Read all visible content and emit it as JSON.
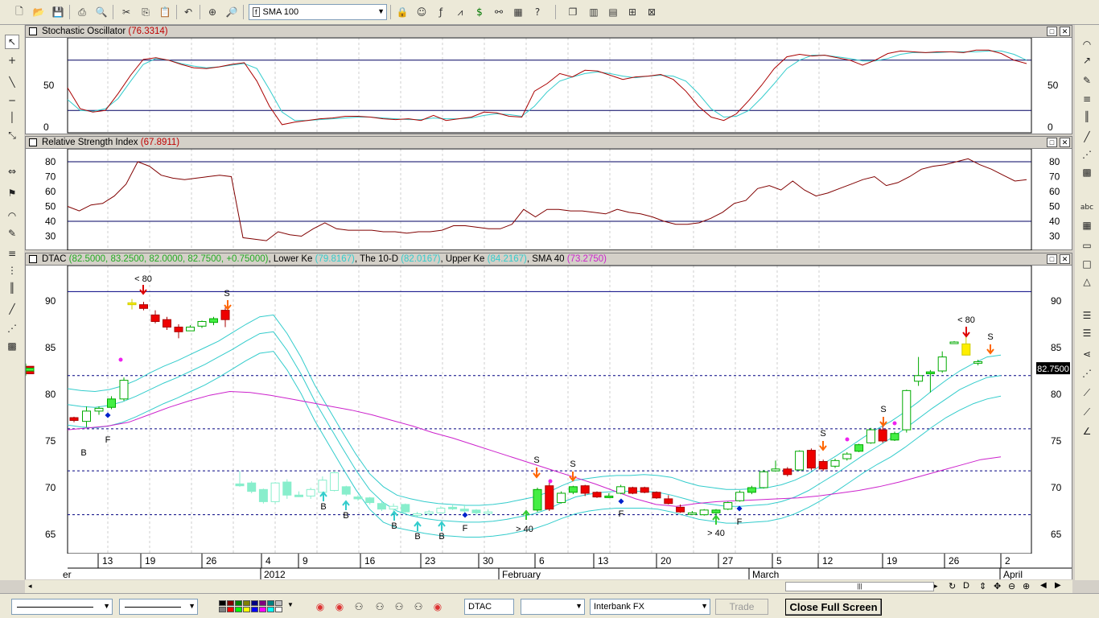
{
  "toolbar": {
    "indicator_select": "SMA 100"
  },
  "stochastic": {
    "title": "Stochastic Oscillator",
    "value": "(76.3314)",
    "axis": [
      "50",
      "0"
    ],
    "upper": 80,
    "lower": 20,
    "k": [
      47,
      22,
      18,
      20,
      40,
      62,
      81,
      83,
      80,
      75,
      71,
      70,
      72,
      75,
      77,
      55,
      25,
      3,
      6,
      8,
      10,
      11,
      13,
      13,
      12,
      10,
      9,
      10,
      8,
      14,
      8,
      10,
      12,
      18,
      17,
      13,
      12,
      43,
      52,
      64,
      60,
      68,
      67,
      62,
      57,
      60,
      61,
      63,
      57,
      43,
      25,
      12,
      8,
      16,
      32,
      50,
      70,
      84,
      87,
      85,
      86,
      83,
      80,
      74,
      80,
      88,
      91,
      90,
      89,
      90,
      90,
      89,
      92,
      92,
      88,
      80,
      76
    ],
    "d": [
      33,
      20,
      19,
      22,
      34,
      55,
      75,
      82,
      80,
      76,
      73,
      71,
      72,
      74,
      76,
      70,
      45,
      18,
      8,
      8,
      9,
      10,
      11,
      12,
      12,
      11,
      10,
      9,
      9,
      11,
      10,
      10,
      11,
      14,
      16,
      15,
      13,
      25,
      42,
      55,
      60,
      64,
      66,
      64,
      61,
      59,
      61,
      62,
      61,
      55,
      40,
      22,
      12,
      13,
      20,
      35,
      52,
      70,
      80,
      86,
      86,
      84,
      82,
      79,
      79,
      82,
      87,
      89,
      89,
      89,
      90,
      90,
      90,
      91,
      91,
      87,
      80
    ]
  },
  "rsi": {
    "title": "Relative Strength Index",
    "value": "(67.8911)",
    "axis": [
      "80",
      "70",
      "60",
      "50",
      "40",
      "30"
    ],
    "upper": 80,
    "lower": 40,
    "values": [
      50,
      47,
      51,
      52,
      57,
      65,
      80,
      77,
      71,
      69,
      68,
      69,
      70,
      71,
      70,
      29,
      28,
      27,
      33,
      31,
      30,
      35,
      39,
      35,
      34,
      34,
      34,
      33,
      33,
      32,
      33,
      33,
      34,
      37,
      37,
      36,
      35,
      35,
      38,
      48,
      43,
      48,
      48,
      47,
      47,
      46,
      45,
      48,
      46,
      45,
      43,
      40,
      38,
      38,
      39,
      42,
      46,
      52,
      54,
      62,
      64,
      61,
      67,
      61,
      57,
      59,
      62,
      65,
      68,
      70,
      64,
      66,
      70,
      75,
      77,
      78,
      80,
      82,
      78,
      75,
      71,
      67,
      68
    ]
  },
  "main": {
    "symbol": "DTAC",
    "ohlc": "(82.5000, 83.2500, 82.0000, 82.7500, +0.75000)",
    "lower_label": "Lower Ke",
    "lower_val": "(79.8167)",
    "mid_label": "The 10-D",
    "mid_val": "(82.0167)",
    "upper_label": "Upper Ke",
    "upper_val": "(84.2167)",
    "sma_label": "SMA 40",
    "sma_val": "(73.2750)",
    "axis": [
      "90",
      "85",
      "80",
      "75",
      "70",
      "65"
    ],
    "last_price": "82.7500"
  },
  "chart_data": {
    "type": "candlestick",
    "ylim": [
      63,
      93
    ],
    "hlines": [
      91,
      82,
      76.3,
      71.8,
      67.1
    ],
    "candles": [
      [
        77.5,
        77.6,
        77.0,
        77.2
      ],
      [
        77.1,
        78.7,
        76.5,
        78.2
      ],
      [
        78.2,
        78.7,
        77.8,
        78.5
      ],
      [
        78.6,
        79.8,
        78.4,
        79.5
      ],
      [
        79.5,
        81.8,
        79.3,
        81.5
      ],
      [
        89.6,
        90.2,
        89.1,
        89.8
      ],
      [
        89.6,
        89.9,
        89.0,
        89.2
      ],
      [
        88.5,
        89.0,
        87.6,
        87.8
      ],
      [
        88.0,
        88.3,
        86.9,
        87.2
      ],
      [
        87.2,
        87.5,
        86.0,
        86.7
      ],
      [
        86.8,
        87.4,
        86.8,
        87.2
      ],
      [
        87.3,
        87.9,
        87.1,
        87.8
      ],
      [
        87.7,
        88.3,
        87.4,
        88.1
      ],
      [
        89.0,
        89.3,
        87.2,
        88.0
      ],
      [
        70.4,
        71.8,
        70.1,
        70.2
      ],
      [
        70.5,
        70.7,
        69.4,
        69.6
      ],
      [
        69.8,
        69.9,
        68.3,
        68.5
      ],
      [
        68.5,
        70.6,
        68.3,
        70.5
      ],
      [
        70.6,
        70.9,
        68.8,
        69.2
      ],
      [
        69.2,
        69.6,
        69.0,
        69.1
      ],
      [
        69.1,
        70.0,
        68.8,
        69.8
      ],
      [
        69.5,
        71.2,
        69.1,
        70.8
      ],
      [
        69.7,
        71.8,
        69.6,
        71.6
      ],
      [
        70.1,
        70.2,
        69.1,
        69.3
      ],
      [
        69.0,
        69.2,
        68.6,
        68.8
      ],
      [
        68.9,
        69.0,
        68.2,
        68.4
      ],
      [
        68.3,
        68.5,
        67.5,
        67.7
      ],
      [
        67.7,
        68.3,
        67.3,
        68.0
      ],
      [
        68.2,
        68.3,
        67.3,
        67.4
      ],
      [
        67.1,
        67.4,
        66.9,
        67.2
      ],
      [
        67.2,
        67.6,
        67.0,
        67.4
      ],
      [
        67.3,
        68.0,
        67.2,
        67.8
      ],
      [
        67.9,
        68.2,
        67.6,
        67.8
      ],
      [
        67.7,
        68.2,
        67.3,
        67.5
      ],
      [
        67.6,
        67.7,
        67.1,
        67.3
      ],
      [
        67.3,
        67.7,
        67.1,
        67.4
      ],
      [
        67.6,
        70.0,
        67.4,
        69.8
      ],
      [
        70.2,
        70.8,
        67.5,
        67.7
      ],
      [
        68.4,
        69.6,
        68.3,
        69.4
      ],
      [
        69.5,
        70.2,
        69.3,
        70.1
      ],
      [
        70.2,
        70.3,
        69.1,
        69.4
      ],
      [
        69.5,
        69.6,
        68.9,
        69.0
      ],
      [
        69.1,
        69.4,
        68.9,
        69.1
      ],
      [
        69.4,
        70.3,
        69.3,
        70.1
      ],
      [
        70.0,
        70.1,
        69.3,
        69.4
      ],
      [
        70.0,
        70.1,
        69.4,
        69.5
      ],
      [
        69.5,
        69.6,
        68.8,
        68.9
      ],
      [
        68.8,
        69.2,
        68.2,
        68.3
      ],
      [
        67.9,
        68.2,
        67.3,
        67.4
      ],
      [
        67.3,
        67.5,
        67.2,
        67.3
      ],
      [
        67.1,
        67.7,
        67.0,
        67.6
      ],
      [
        67.3,
        67.7,
        67.0,
        67.6
      ],
      [
        67.7,
        68.5,
        67.6,
        68.4
      ],
      [
        68.6,
        69.7,
        68.5,
        69.5
      ],
      [
        69.5,
        70.2,
        69.3,
        70.0
      ],
      [
        70.0,
        71.9,
        69.9,
        71.7
      ],
      [
        71.8,
        72.9,
        71.7,
        72.0
      ],
      [
        72.0,
        72.2,
        71.2,
        71.4
      ],
      [
        71.9,
        74.0,
        71.8,
        73.9
      ],
      [
        74.0,
        74.2,
        71.9,
        72.1
      ],
      [
        72.8,
        73.0,
        71.8,
        72.0
      ],
      [
        72.3,
        73.1,
        72.1,
        72.9
      ],
      [
        73.1,
        73.8,
        72.9,
        73.6
      ],
      [
        73.9,
        74.7,
        73.8,
        74.6
      ],
      [
        74.8,
        76.4,
        74.7,
        76.2
      ],
      [
        76.2,
        77.0,
        74.8,
        75.0
      ],
      [
        75.1,
        76.0,
        75.0,
        75.8
      ],
      [
        76.2,
        80.5,
        75.9,
        80.4
      ],
      [
        81.4,
        84.0,
        80.9,
        82.0
      ],
      [
        82.2,
        82.6,
        80.2,
        82.4
      ],
      [
        82.5,
        84.6,
        82.3,
        84.0
      ],
      [
        85.5,
        85.7,
        85.4,
        85.6
      ],
      [
        85.4,
        86.6,
        84.3,
        84.2
      ],
      [
        83.4,
        83.7,
        83.1,
        83.5
      ],
      [
        83.0,
        83.2,
        82.0,
        82.2
      ],
      [
        82.5,
        83.3,
        82.0,
        82.8
      ]
    ],
    "upper_band": [
      80.6,
      80.4,
      80.3,
      80.5,
      80.9,
      81.5,
      82.3,
      83.0,
      83.6,
      84.3,
      85.0,
      85.7,
      86.6,
      87.5,
      88.3,
      88.5,
      86.5,
      84,
      81,
      78.5,
      76,
      73.6,
      71.5,
      70.1,
      69.2,
      68.8,
      68.5,
      68.3,
      68.2,
      68.1,
      68.1,
      68.2,
      68.4,
      68.7,
      69.0,
      69.5,
      70.2,
      70.8,
      71.0,
      71.2,
      71.3,
      71.3,
      71.4,
      71.3,
      71.1,
      70.6,
      70.2,
      70.0,
      69.8,
      69.8,
      69.9,
      70.0,
      70.3,
      70.8,
      71.5,
      72.5,
      73.4,
      74.4,
      75.4,
      76.3,
      77.1,
      78.1,
      79.2,
      80.4,
      81.5,
      82.5,
      83.3,
      84.0,
      84.2
    ],
    "mid_band": [
      78.9,
      78.7,
      78.6,
      78.8,
      79.2,
      79.8,
      80.5,
      81.2,
      81.8,
      82.5,
      83.2,
      84.0,
      84.8,
      85.7,
      86.5,
      86.7,
      84.7,
      82.2,
      79.3,
      76.8,
      74.3,
      71.9,
      69.8,
      68.4,
      67.5,
      67.0,
      66.7,
      66.5,
      66.4,
      66.3,
      66.3,
      66.4,
      66.6,
      66.9,
      67.2,
      67.7,
      68.4,
      69.0,
      69.3,
      69.5,
      69.6,
      69.6,
      69.6,
      69.5,
      69.2,
      68.8,
      68.4,
      68.2,
      68.0,
      68.0,
      68.1,
      68.2,
      68.5,
      69.0,
      69.7,
      70.6,
      71.5,
      72.5,
      73.5,
      74.4,
      75.3,
      76.3,
      77.4,
      78.5,
      79.5,
      80.5,
      81.2,
      81.8,
      82.0
    ],
    "lower_band": [
      76.7,
      76.5,
      76.4,
      76.6,
      77.0,
      77.6,
      78.3,
      79.0,
      79.6,
      80.3,
      81.0,
      81.8,
      82.7,
      83.6,
      84.4,
      84.6,
      82.6,
      80.1,
      77.2,
      74.7,
      72.2,
      69.8,
      67.7,
      66.3,
      65.7,
      65.4,
      65.1,
      64.9,
      64.8,
      64.7,
      64.7,
      64.8,
      65.0,
      65.3,
      65.6,
      66.1,
      66.7,
      67.2,
      67.5,
      67.7,
      67.8,
      67.8,
      67.8,
      67.7,
      67.4,
      67.0,
      66.6,
      66.4,
      66.2,
      66.2,
      66.3,
      66.4,
      66.7,
      67.2,
      67.9,
      68.7,
      69.6,
      70.6,
      71.6,
      72.5,
      73.3,
      74.3,
      75.4,
      76.5,
      77.5,
      78.3,
      79.0,
      79.5,
      79.8
    ],
    "sma40": [
      76.2,
      76.4,
      76.6,
      77,
      77.8,
      78.6,
      79.3,
      79.9,
      80.3,
      80.2,
      79.9,
      79.5,
      79.1,
      78.7,
      78.3,
      77.8,
      77.2,
      76.6,
      75.9,
      75.3,
      74.6,
      73.9,
      73.2,
      72.5,
      71.8,
      71.1,
      70.4,
      69.6,
      68.8,
      68.2,
      68.0,
      68.3,
      68.5,
      68.6,
      68.7,
      68.8,
      68.9,
      69.1,
      69.4,
      69.7,
      70.1,
      70.6,
      71.2,
      71.8,
      72.4,
      73.0,
      73.3
    ],
    "annotations": [
      "< 80",
      "S",
      "B",
      "F",
      "> 40",
      "< 80",
      "S"
    ]
  },
  "xaxis": {
    "ticks": [
      "13",
      "19",
      "26",
      "4",
      "9",
      "16",
      "23",
      "30",
      "6",
      "13",
      "20",
      "27",
      "5",
      "12",
      "19",
      "26",
      "2"
    ],
    "months": [
      "2012",
      "February",
      "March",
      "April"
    ],
    "left_cut": "er"
  },
  "bottom": {
    "symbol": "DTAC",
    "feed": "Interbank FX",
    "trade": "Trade",
    "close_fullscreen": "Close Full Screen"
  },
  "colors": {
    "bull_green": "#44ee44",
    "bull_outline": "#00aa00",
    "bear_red": "#ee0000",
    "cyan_faded": "#88eecc",
    "band": "#33cccc",
    "sma": "#cc22cc",
    "stoch_k": "#aa0000",
    "stoch_d": "#33cccc"
  }
}
